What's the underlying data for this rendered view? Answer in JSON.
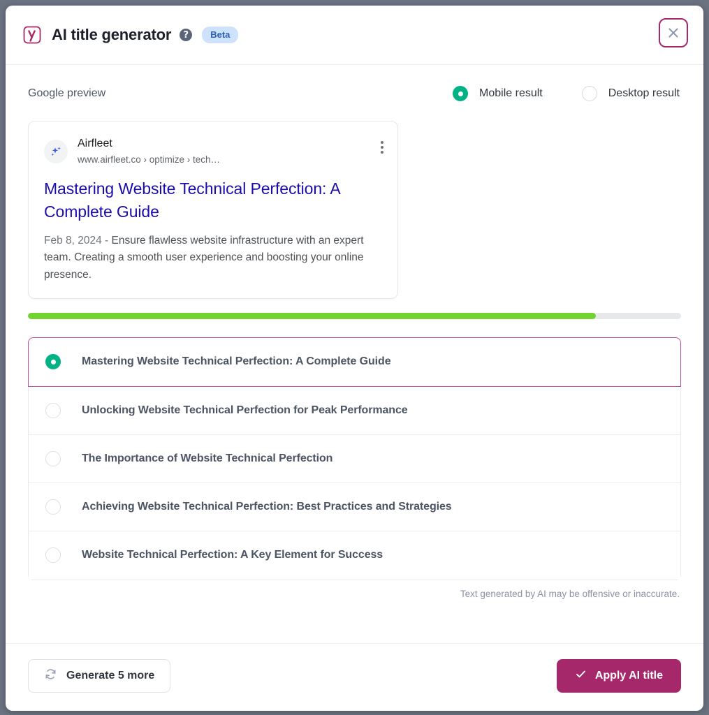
{
  "header": {
    "logo_icon": "yoast-logo-icon",
    "title": "AI title generator",
    "help_icon": "help-question-icon",
    "help_glyph": "?",
    "badge": "Beta",
    "close_icon": "close-icon"
  },
  "preview": {
    "section_label": "Google preview",
    "devices": [
      {
        "label": "Mobile result",
        "selected": true
      },
      {
        "label": "Desktop result",
        "selected": false
      }
    ]
  },
  "serp": {
    "favicon_icon": "sparkle-favicon-icon",
    "site_name": "Airfleet",
    "url": "www.airfleet.co › optimize › tech…",
    "kebab_icon": "more-options-icon",
    "title": "Mastering Website Technical Perfection: A Complete Guide",
    "date": "Feb 8, 2024",
    "separator": "-",
    "description": "Ensure flawless website infrastructure with an expert team. Creating a smooth user experience and boosting your online presence."
  },
  "progress": {
    "percent": 87
  },
  "titles": [
    {
      "label": "Mastering Website Technical Perfection: A Complete Guide",
      "selected": true
    },
    {
      "label": "Unlocking Website Technical Perfection for Peak Performance",
      "selected": false
    },
    {
      "label": "The Importance of Website Technical Perfection",
      "selected": false
    },
    {
      "label": "Achieving Website Technical Perfection: Best Practices and Strategies",
      "selected": false
    },
    {
      "label": "Website Technical Perfection: A Key Element for Success",
      "selected": false
    }
  ],
  "disclaimer": "Text generated by AI may be offensive or inaccurate.",
  "footer": {
    "generate_icon": "refresh-icon",
    "generate_label": "Generate 5 more",
    "apply_icon": "check-icon",
    "apply_label": "Apply AI title"
  },
  "colors": {
    "brand_magenta": "#a4286a",
    "selected_border": "#c0509a",
    "radio_green": "#00b285",
    "progress_green": "#73d431",
    "serp_link_blue": "#1a0dab",
    "beta_badge_bg": "#cfe2fb",
    "beta_badge_text": "#2b5fb4"
  }
}
